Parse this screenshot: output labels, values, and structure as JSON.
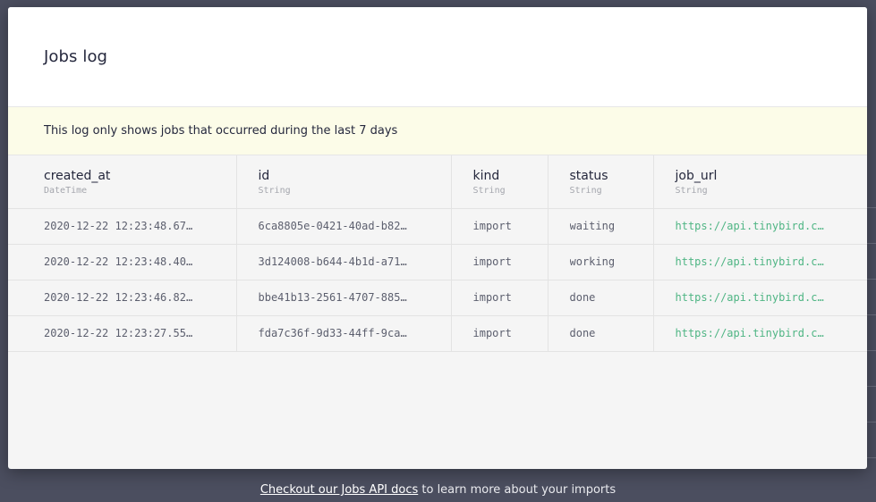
{
  "modal": {
    "title": "Jobs log",
    "notice": "This log only shows jobs that occurred during the last 7 days"
  },
  "columns": [
    {
      "name": "created_at",
      "type": "DateTime"
    },
    {
      "name": "id",
      "type": "String"
    },
    {
      "name": "kind",
      "type": "String"
    },
    {
      "name": "status",
      "type": "String"
    },
    {
      "name": "job_url",
      "type": "String"
    }
  ],
  "rows": [
    {
      "created_at": "2020-12-22 12:23:48.67…",
      "id": "6ca8805e-0421-40ad-b82…",
      "kind": "import",
      "status": "waiting",
      "job_url": "https://api.tinybird.c…"
    },
    {
      "created_at": "2020-12-22 12:23:48.40…",
      "id": "3d124008-b644-4b1d-a71…",
      "kind": "import",
      "status": "working",
      "job_url": "https://api.tinybird.c…"
    },
    {
      "created_at": "2020-12-22 12:23:46.82…",
      "id": "bbe41b13-2561-4707-885…",
      "kind": "import",
      "status": "done",
      "job_url": "https://api.tinybird.c…"
    },
    {
      "created_at": "2020-12-22 12:23:27.55…",
      "id": "fda7c36f-9d33-44ff-9ca…",
      "kind": "import",
      "status": "done",
      "job_url": "https://api.tinybird.c…"
    }
  ],
  "footer": {
    "link_text": "Checkout our Jobs API docs",
    "rest_text": " to learn more about your imports"
  },
  "colors": {
    "link": "#4fb584",
    "notice_bg": "#fcfce8",
    "backdrop": "#4b4e5f"
  }
}
